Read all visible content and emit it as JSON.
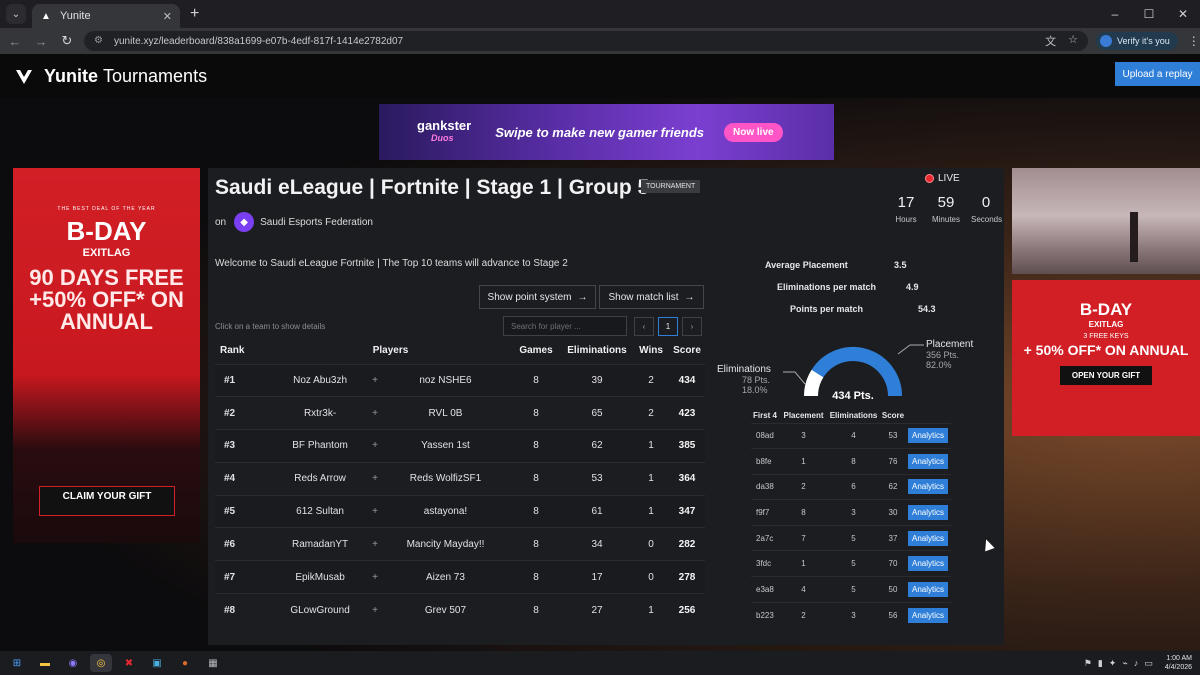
{
  "browser": {
    "tab_title": "Yunite",
    "tab_close": "✕",
    "new_tab": "+",
    "url": "yunite.xyz/leaderboard/838a1699-e07b-4edf-817f-1414e2782d07",
    "verify_label": "Verify it's you",
    "window_controls": [
      "–",
      "☐",
      "✕"
    ]
  },
  "site": {
    "brand_bold": "Yunite",
    "brand_rest": "Tournaments",
    "upload_label": "Upload a replay"
  },
  "ads": {
    "top_brand": "gankster",
    "top_sub": "Duos",
    "top_text": "Swipe to make new gamer friends",
    "top_cta": "Now live",
    "left_small": "THE BEST DEAL OF THE YEAR",
    "left_bday": "B-DAY",
    "left_brand": "EXITLAG",
    "left_big": "90 DAYS FREE +50% OFF* ON ANNUAL",
    "left_cta": "CLAIM YOUR GIFT",
    "right_bday": "B-DAY",
    "right_brand": "EXITLAG",
    "right_keys": "3 FREE KEYS",
    "right_off": "+ 50% OFF* ON ANNUAL",
    "right_cta": "OPEN YOUR GIFT"
  },
  "tournament": {
    "title": "Saudi eLeague | Fortnite | Stage 1 | Group 5",
    "badge": "TOURNAMENT",
    "on_label": "on",
    "organizer": "Saudi Esports Federation",
    "live_label": "LIVE",
    "countdown": [
      {
        "value": "17",
        "unit": "Hours"
      },
      {
        "value": "59",
        "unit": "Minutes"
      },
      {
        "value": "0",
        "unit": "Seconds"
      }
    ],
    "welcome": "Welcome to Saudi eLeague Fortnite | The Top 10 teams will advance to Stage 2",
    "point_system_label": "Show point system",
    "match_list_label": "Show match list",
    "hint": "Click on a team to show details",
    "search_placeholder": "Search for player ...",
    "page_current": "1"
  },
  "leaderboard": {
    "headers": {
      "rank": "Rank",
      "players": "Players",
      "games": "Games",
      "elims": "Eliminations",
      "wins": "Wins",
      "score": "Score"
    },
    "rows": [
      {
        "rank": "#1",
        "p1": "Noz Abu3zh",
        "p2": "noz NSHE6",
        "games": "8",
        "elims": "39",
        "wins": "2",
        "score": "434"
      },
      {
        "rank": "#2",
        "p1": "Rxtr3k-",
        "p2": "RVL 0B",
        "games": "8",
        "elims": "65",
        "wins": "2",
        "score": "423"
      },
      {
        "rank": "#3",
        "p1": "BF Phantom",
        "p2": "Yassen 1st",
        "games": "8",
        "elims": "62",
        "wins": "1",
        "score": "385"
      },
      {
        "rank": "#4",
        "p1": "Reds Arrow",
        "p2": "Reds WolfizSF1",
        "games": "8",
        "elims": "53",
        "wins": "1",
        "score": "364"
      },
      {
        "rank": "#5",
        "p1": "612 Sultan",
        "p2": "astayona!",
        "games": "8",
        "elims": "61",
        "wins": "1",
        "score": "347"
      },
      {
        "rank": "#6",
        "p1": "RamadanYT",
        "p2": "Mancity Mayday!!",
        "games": "8",
        "elims": "34",
        "wins": "0",
        "score": "282"
      },
      {
        "rank": "#7",
        "p1": "EpikMusab",
        "p2": "Aizen 73",
        "games": "8",
        "elims": "17",
        "wins": "0",
        "score": "278"
      },
      {
        "rank": "#8",
        "p1": "GLowGround",
        "p2": "Grev 507",
        "games": "8",
        "elims": "27",
        "wins": "1",
        "score": "256"
      }
    ],
    "plus_sign": "+"
  },
  "team_details": {
    "avg_placement_label": "Average Placement",
    "avg_placement_value": "3.5",
    "elims_per_match_label": "Eliminations per match",
    "elims_per_match_value": "4.9",
    "points_per_match_label": "Points per match",
    "points_per_match_value": "54.3",
    "total_points": "434 Pts.",
    "elims_label": "Eliminations",
    "elims_pts": "78 Pts.",
    "elims_pct": "18.0%",
    "placement_label": "Placement",
    "placement_pts": "356 Pts.",
    "placement_pct": "82.0%",
    "placement_fraction": 0.82,
    "match_headers": [
      "First 4",
      "Placement",
      "Eliminations",
      "Score"
    ],
    "analytics_label": "Analytics",
    "matches": [
      {
        "id": "08ad",
        "placement": "3",
        "elims": "4",
        "score": "53"
      },
      {
        "id": "b8fe",
        "placement": "1",
        "elims": "8",
        "score": "76"
      },
      {
        "id": "da38",
        "placement": "2",
        "elims": "6",
        "score": "62"
      },
      {
        "id": "f9f7",
        "placement": "8",
        "elims": "3",
        "score": "30"
      },
      {
        "id": "2a7c",
        "placement": "7",
        "elims": "5",
        "score": "37"
      },
      {
        "id": "3fdc",
        "placement": "1",
        "elims": "5",
        "score": "70"
      },
      {
        "id": "e3a8",
        "placement": "4",
        "elims": "5",
        "score": "50"
      },
      {
        "id": "b223",
        "placement": "2",
        "elims": "3",
        "score": "56"
      }
    ]
  },
  "system": {
    "time": "1:00 AM",
    "date": "4/4/2026"
  },
  "colors": {
    "accent": "#2f7fd8",
    "live": "#e5292f",
    "ad_red": "#d21f26",
    "gauge_blue": "#2f7fd8",
    "gauge_white": "#ffffff"
  }
}
